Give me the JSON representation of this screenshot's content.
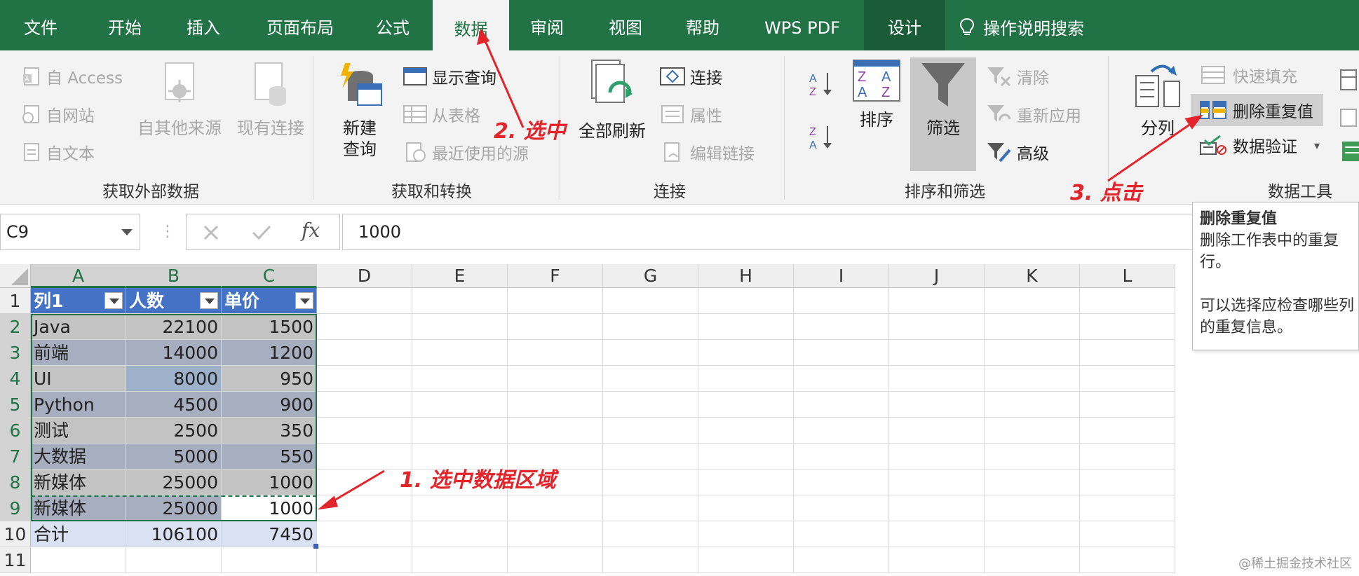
{
  "tabs": [
    "文件",
    "开始",
    "插入",
    "页面布局",
    "公式",
    "数据",
    "审阅",
    "视图",
    "帮助",
    "WPS PDF",
    "设计"
  ],
  "active_tab": "数据",
  "tell_me": "操作说明搜索",
  "groups": {
    "external": {
      "label": "获取外部数据",
      "access": "自 Access",
      "web": "自网站",
      "text": "自文本",
      "other_sources": "自其他来源",
      "existing": "现有连接"
    },
    "transform": {
      "label": "获取和转换",
      "new_query_line1": "新建",
      "new_query_line2": "查询",
      "show_query": "显示查询",
      "from_table": "从表格",
      "recent_sources": "最近使用的源"
    },
    "connections": {
      "label": "连接",
      "refresh_all": "全部刷新",
      "connections": "连接",
      "properties": "属性",
      "edit_links": "编辑链接"
    },
    "sort_filter": {
      "label": "排序和筛选",
      "sort": "排序",
      "filter": "筛选",
      "clear": "清除",
      "reapply": "重新应用",
      "advanced": "高级"
    },
    "data_tools": {
      "label": "数据工具",
      "text_to_columns": "分列",
      "flash_fill": "快速填充",
      "remove_duplicates": "删除重复值",
      "data_validation": "数据验证"
    }
  },
  "formula_bar": {
    "name_box": "C9",
    "fx": "fx",
    "value": "1000"
  },
  "columns": [
    "A",
    "B",
    "C",
    "D",
    "E",
    "F",
    "G",
    "H",
    "I",
    "J",
    "K",
    "L"
  ],
  "rows": [
    "1",
    "2",
    "3",
    "4",
    "5",
    "6",
    "7",
    "8",
    "9",
    "10",
    "11"
  ],
  "table": {
    "headers": [
      "列1",
      "人数",
      "单价"
    ],
    "data": [
      [
        "Java",
        "22100",
        "1500"
      ],
      [
        "前端",
        "14000",
        "1200"
      ],
      [
        "UI",
        "8000",
        "950"
      ],
      [
        "Python",
        "4500",
        "900"
      ],
      [
        "测试",
        "2500",
        "350"
      ],
      [
        "大数据",
        "5000",
        "550"
      ],
      [
        "新媒体",
        "25000",
        "1000"
      ],
      [
        "新媒体",
        "25000",
        "1000"
      ],
      [
        "合计",
        "106100",
        "7450"
      ]
    ]
  },
  "tooltip": {
    "title": "删除重复值",
    "line1": "删除工作表中的重复",
    "line2": "行。",
    "line3": "可以选择应检查哪些列",
    "line4": "的重复信息。"
  },
  "annotations": {
    "step1": "1. 选中数据区域",
    "step2": "2. 选中",
    "step3": "3. 点击"
  },
  "watermark": "@稀土掘金技术社区"
}
